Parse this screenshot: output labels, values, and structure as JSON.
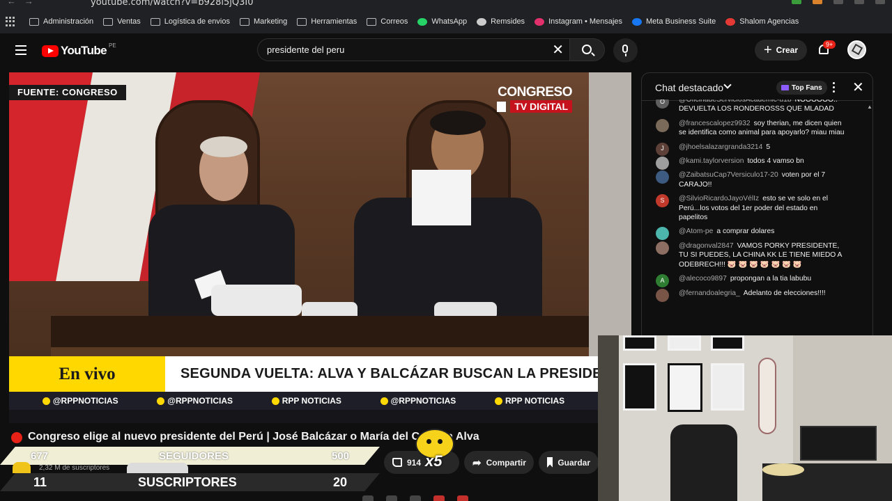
{
  "browser": {
    "url": "youtube.com/watch?v=b928l5jQ3I0",
    "bookmarks": [
      {
        "label": "Administración",
        "icon": "folder-icon"
      },
      {
        "label": "Ventas",
        "icon": "folder-icon"
      },
      {
        "label": "Logística de envios",
        "icon": "folder-icon"
      },
      {
        "label": "Marketing",
        "icon": "folder-icon"
      },
      {
        "label": "Herramientas",
        "icon": "folder-icon"
      },
      {
        "label": "Correos",
        "icon": "folder-icon"
      },
      {
        "label": "WhatsApp",
        "icon": "whatsapp-icon",
        "color": "#25d366"
      },
      {
        "label": "Remsides",
        "icon": "sheet-icon",
        "color": "#cccccc"
      },
      {
        "label": "Instagram • Mensajes",
        "icon": "instagram-icon",
        "color": "#e1306c"
      },
      {
        "label": "Meta Business Suite",
        "icon": "meta-icon",
        "color": "#1877f2"
      },
      {
        "label": "Shalom Agencias",
        "icon": "shalom-icon",
        "color": "#e53935"
      }
    ]
  },
  "header": {
    "logo_text": "YouTube",
    "country_code": "PE",
    "search_query": "presidente del peru",
    "create_label": "Crear",
    "notifications_badge": "9+"
  },
  "video": {
    "source_label": "FUENTE: CONGRESO",
    "channel_logo_top": "CONGRESO",
    "channel_logo_bottom": "TV DIGITAL",
    "live_label": "En vivo",
    "headline": "SEGUNDA VUELTA: ALVA Y BALCÁZAR BUSCAN LA PRESIDENCIA",
    "socials": [
      {
        "label": "@RPPNOTICIAS",
        "icon": "instagram-icon"
      },
      {
        "label": "@RPPNOTICIAS",
        "icon": "x-icon"
      },
      {
        "label": "RPP NOTICIAS",
        "icon": "facebook-icon"
      },
      {
        "label": "@RPPNOTICIAS",
        "icon": "tiktok-icon"
      },
      {
        "label": "RPP NOTICIAS",
        "icon": "youtube-icon"
      }
    ]
  },
  "details": {
    "title": "Congreso elige al nuevo presidente del Perú | José Balcázar o María del Carmen Alva",
    "subscribers": "2,32 M de suscriptores",
    "like_count": "914",
    "share_label": "Compartir",
    "save_label": "Guardar",
    "overlay_multiplier": "x5"
  },
  "overlay_stats": {
    "followers_current": "677",
    "followers_label": "SEGUIDORES",
    "followers_goal": "500",
    "subs_current": "11",
    "subs_label": "SUSCRIPTORES",
    "subs_goal": "20"
  },
  "chat": {
    "title": "Chat destacado",
    "top_fans_label": "Top Fans",
    "messages": [
      {
        "author": "@OficinadeServiciosAcademic-u1b",
        "text": "NOOOOOO.. DEVUELTA LOS RONDEROSSS QUE MLADAD",
        "avatar_letter": "O",
        "avatar_color": "#5f5f5f"
      },
      {
        "author": "@francescalopez9932",
        "text": "soy therian, me dicen quien se identifica como animal para apoyarlo? miau miau",
        "avatar_letter": "",
        "avatar_color": "#7a6a5a"
      },
      {
        "author": "@jhoelsalazargranda3214",
        "text": "5",
        "avatar_letter": "J",
        "avatar_color": "#5d4037"
      },
      {
        "author": "@kami.taylorversion",
        "text": "todos 4 vamso bn",
        "avatar_letter": "",
        "avatar_color": "#9e9e9e"
      },
      {
        "author": "@ZaibatsuCap7Versiculo17-20",
        "text": "voten por el 7 CARAJO!!",
        "avatar_letter": "",
        "avatar_color": "#3d5a80"
      },
      {
        "author": "@SilvioRicardoJayoVélIz",
        "text": "esto se ve solo en el Perú...los votos del 1er poder del estado en papelitos",
        "avatar_letter": "S",
        "avatar_color": "#c0392b"
      },
      {
        "author": "@Atom-pe",
        "text": "a comprar dolares",
        "avatar_letter": "",
        "avatar_color": "#4db6ac"
      },
      {
        "author": "@dragonval2847",
        "text": "VAMOS PORKY PRESIDENTE, TU SI PUEDES, LA CHINA KK LE TIENE MIEDO A ODEBRECH!!! 🐷 🐷 🐷 🐷 🐷 🐷 🐷",
        "avatar_letter": "",
        "avatar_color": "#8d6e63"
      },
      {
        "author": "@alecoco9897",
        "text": "propongan a la tia labubu",
        "avatar_letter": "A",
        "avatar_color": "#2e7d32"
      },
      {
        "author": "@fernandoalegria_",
        "text": "Adelanto de elecciones!!!!",
        "avatar_letter": "",
        "avatar_color": "#795548"
      }
    ]
  }
}
